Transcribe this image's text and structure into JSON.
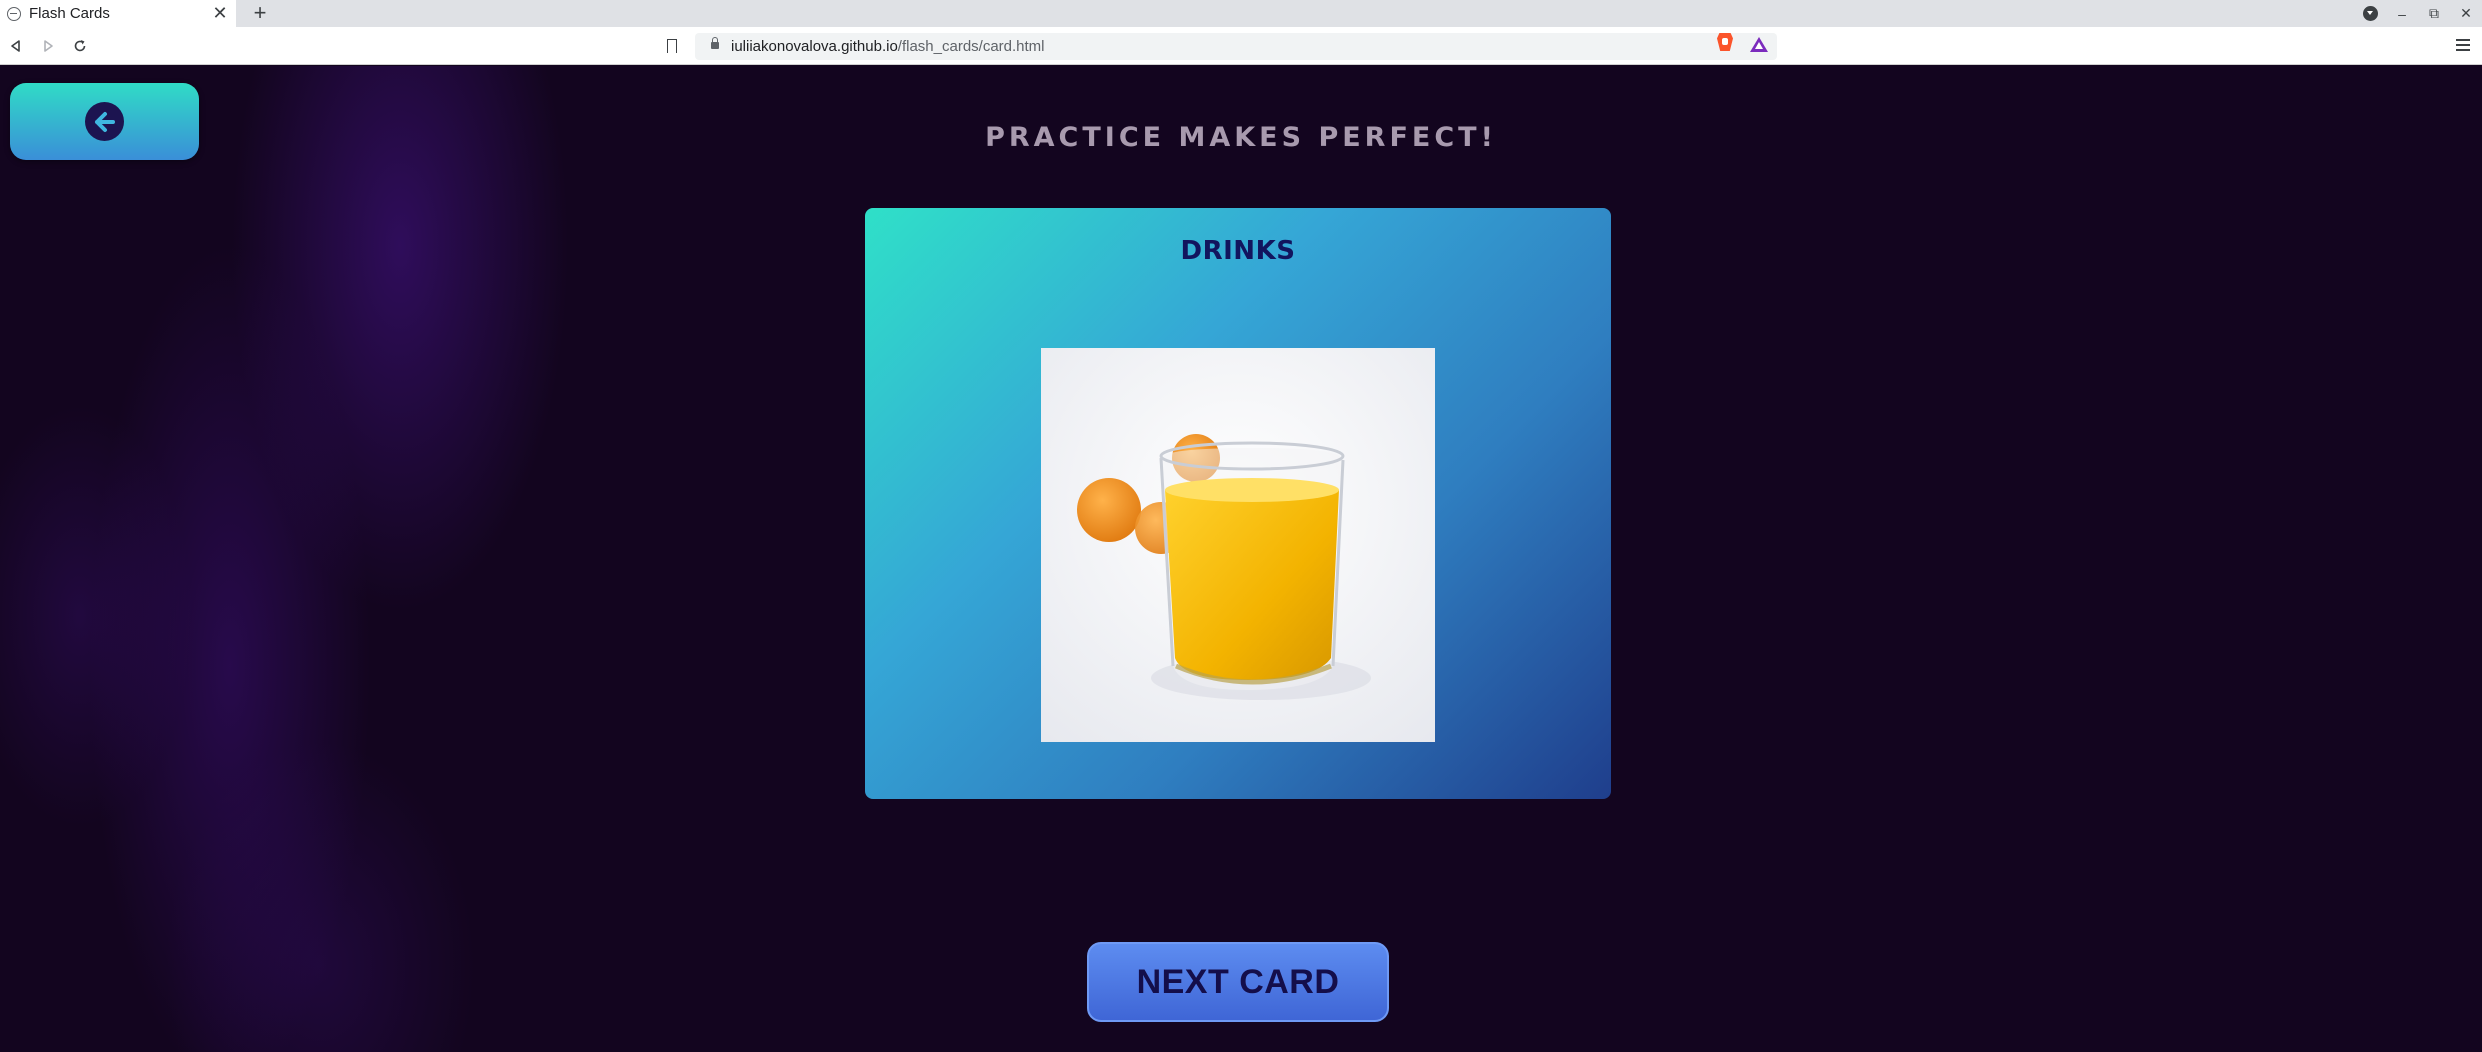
{
  "browser": {
    "tab_title": "Flash Cards",
    "tab_close": "✕",
    "new_tab": "+",
    "url_host": "iuliiakonovalova.github.io",
    "url_path": "/flash_cards/card.html",
    "window_controls": {
      "minimize": "–",
      "restore": "⧉",
      "close": "✕"
    }
  },
  "page": {
    "heading": "PRACTICE MAKES PERFECT!",
    "back_button_icon": "arrow-left-circle-icon"
  },
  "card": {
    "category": "DRINKS",
    "image_subject": "glass-of-orange-juice-with-oranges",
    "colors": {
      "gradient_start": "#2fe0c8",
      "gradient_end": "#1f3e8c",
      "title": "#12155e"
    }
  },
  "next_button": {
    "label": "NEXT CARD",
    "color": "#4a74e0"
  },
  "colors": {
    "background": "#13051f",
    "heading": "#a89aae"
  }
}
